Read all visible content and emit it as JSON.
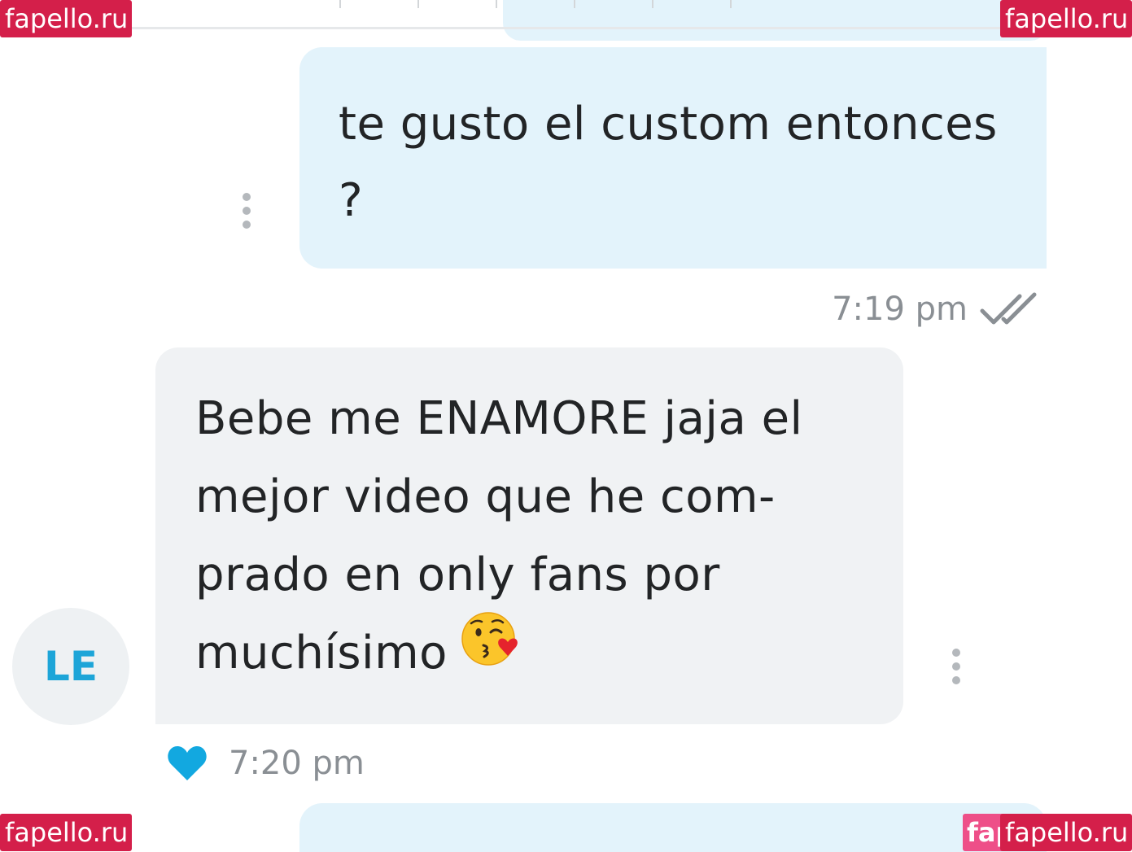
{
  "watermarks": {
    "top_left": "fapello.ru",
    "top_right": "fapello.ru",
    "bottom_left": "fapello.ru",
    "bottom_right": "fapello.ru"
  },
  "conversation": {
    "outgoing_message": {
      "text": "te gusto el custom entonces\n?",
      "time": "7:19 pm",
      "status_icon": "double-check-icon",
      "options_icon": "more-vertical-icon"
    },
    "incoming_message": {
      "sender_initials": "LE",
      "text": "Bebe me ENAMORE jaja el\nmejor video que he com-\nprado en only fans por\nmuchísimo",
      "emoji": "face-blowing-a-kiss",
      "time": "7:20 pm",
      "like_icon": "heart-icon",
      "options_icon": "more-vertical-icon"
    }
  },
  "colors": {
    "outgoing_bubble": "#e3f3fb",
    "incoming_bubble": "#f0f2f4",
    "accent_blue": "#1da5d8",
    "heart": "#12a8e0",
    "watermark_bg": "#d41f4a",
    "timestamp": "#8a8f94"
  }
}
